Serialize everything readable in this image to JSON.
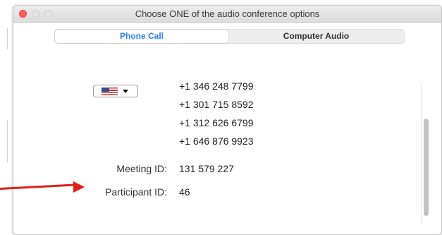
{
  "window": {
    "title": "Choose ONE of the audio conference options"
  },
  "tabs": [
    {
      "label": "Phone Call",
      "selected": true
    },
    {
      "label": "Computer Audio",
      "selected": false
    }
  ],
  "country_select": {
    "icon": "us-flag-icon"
  },
  "phone_numbers": [
    "+1 346 248 7799",
    "+1 301 715 8592",
    "+1 312 626 6799",
    "+1 646 876 9923"
  ],
  "meeting": {
    "id_label": "Meeting ID:",
    "id_value": "131 579 227",
    "participant_label": "Participant ID:",
    "participant_value": "46"
  },
  "colors": {
    "accent": "#2d7ff9",
    "annotation_arrow": "#e0201a",
    "close_button": "#ff5f57"
  }
}
